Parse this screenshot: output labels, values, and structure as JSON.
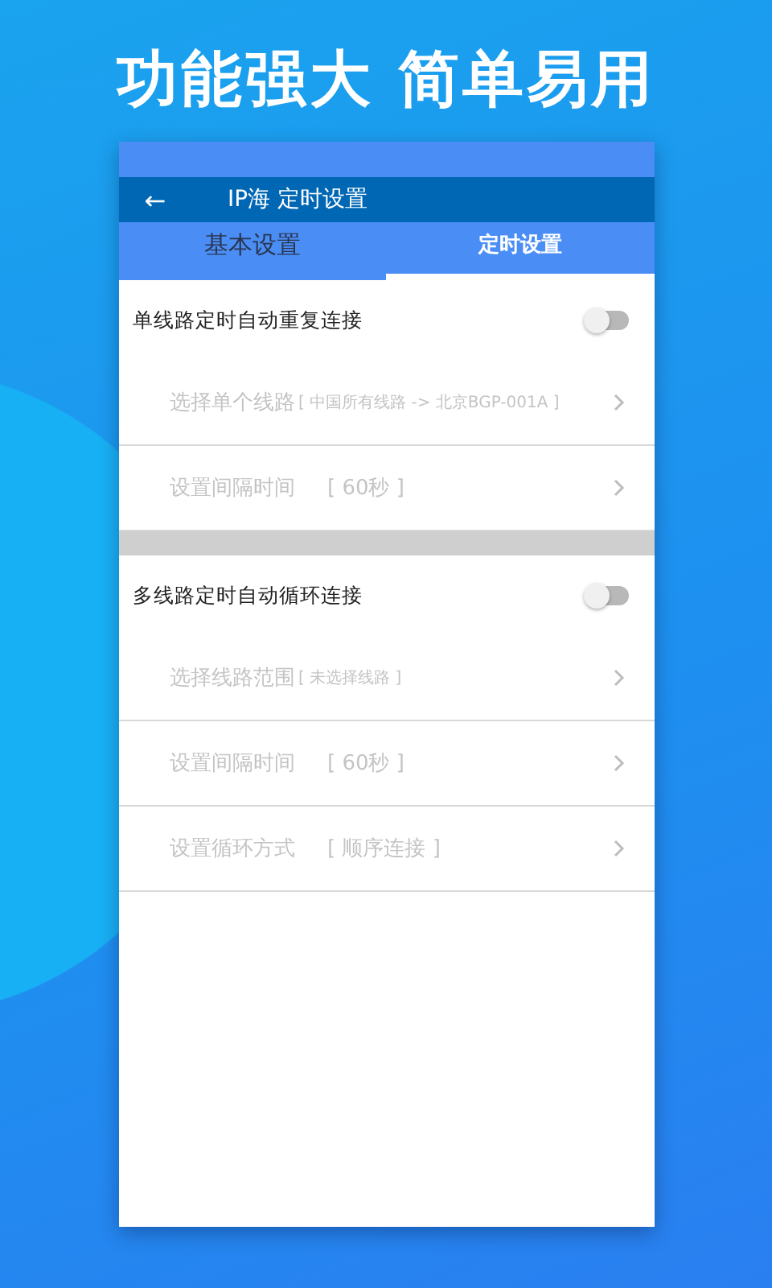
{
  "headline": "功能强大 简单易用",
  "app_bar": {
    "back": "←",
    "title": "IP海 定时设置"
  },
  "tabs": [
    {
      "label": "基本设置",
      "selected": false
    },
    {
      "label": "定时设置",
      "selected": true
    }
  ],
  "sections": [
    {
      "toggle": {
        "label": "单线路定时自动重复连接",
        "on": false
      },
      "rows": [
        {
          "label": "选择单个线路",
          "value": "[ 中国所有线路 -> 北京BGP-001A ]",
          "small": true,
          "disabled": true
        },
        {
          "label": "设置间隔时间",
          "value": "[ 60秒 ]",
          "small": false,
          "disabled": true
        }
      ]
    },
    {
      "toggle": {
        "label": "多线路定时自动循环连接",
        "on": false
      },
      "rows": [
        {
          "label": "选择线路范围",
          "value": "[ 未选择线路 ]",
          "small": true,
          "disabled": true
        },
        {
          "label": "设置间隔时间",
          "value": "[ 60秒 ]",
          "small": false,
          "disabled": true
        },
        {
          "label": "设置循环方式",
          "value": "[ 顺序连接 ]",
          "small": false,
          "disabled": true
        }
      ]
    }
  ]
}
